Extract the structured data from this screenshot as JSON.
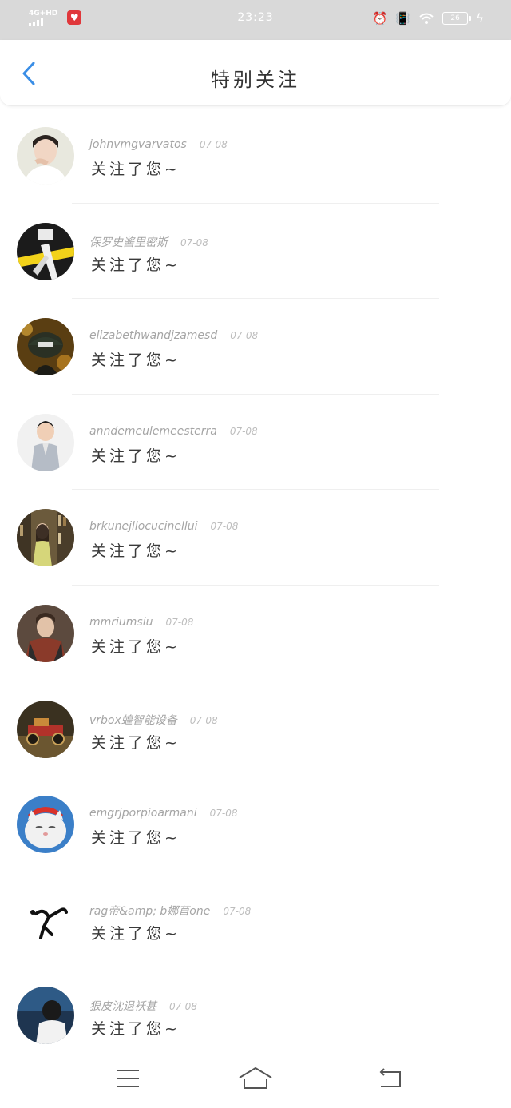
{
  "status_bar": {
    "network": "4G+HD",
    "time": "23:23",
    "battery": "26"
  },
  "header": {
    "title": "特别关注"
  },
  "items": [
    {
      "name": "johnvmgvarvatos",
      "date": "07-08",
      "message": "关注了您~"
    },
    {
      "name": "保罗史酱里密斯",
      "date": "07-08",
      "message": "关注了您~"
    },
    {
      "name": "elizabethwandjzamesd",
      "date": "07-08",
      "message": "关注了您~"
    },
    {
      "name": "anndemeulemeesterra",
      "date": "07-08",
      "message": "关注了您~"
    },
    {
      "name": "brkunejllocucinellui",
      "date": "07-08",
      "message": "关注了您~"
    },
    {
      "name": "mmriumsiu",
      "date": "07-08",
      "message": "关注了您~"
    },
    {
      "name": "vrbox蝗智能设备",
      "date": "07-08",
      "message": "关注了您~"
    },
    {
      "name": "emgrjporpioarmani",
      "date": "07-08",
      "message": "关注了您~"
    },
    {
      "name": "rag帝&amp; b娜苜one",
      "date": "07-08",
      "message": "关注了您~"
    },
    {
      "name": "狠皮沈退袄甚",
      "date": "07-08",
      "message": "关注了您~"
    }
  ],
  "icons": {
    "back": "chevron-left-icon",
    "menu": "menu-icon",
    "home": "home-icon",
    "return": "return-icon"
  },
  "colors": {
    "accent": "#3a8ee6",
    "status_bar_bg": "#d9d9d9"
  }
}
